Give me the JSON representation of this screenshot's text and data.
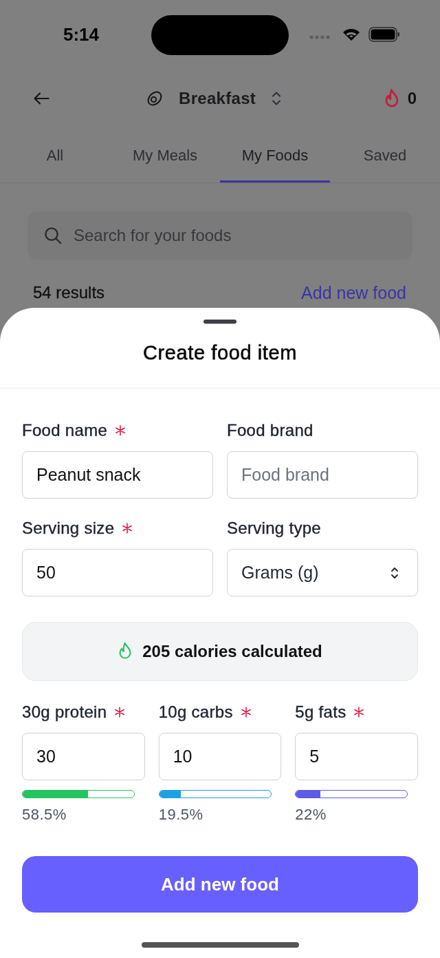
{
  "status_bar": {
    "time": "5:14"
  },
  "header": {
    "meal": "Breakfast",
    "streak": "0"
  },
  "tabs": [
    {
      "label": "All",
      "selected": false
    },
    {
      "label": "My Meals",
      "selected": false
    },
    {
      "label": "My Foods",
      "selected": true
    },
    {
      "label": "Saved",
      "selected": false
    }
  ],
  "search": {
    "placeholder": "Search for your foods"
  },
  "results": {
    "count": "54 results",
    "action": "Add new food"
  },
  "sheet": {
    "title": "Create food item",
    "fields": [
      {
        "label": "Food name",
        "required": true,
        "kind": "text",
        "value": "Peanut snack"
      },
      {
        "label": "Food brand",
        "required": false,
        "kind": "text",
        "placeholder": "Food brand"
      },
      {
        "label": "Serving size",
        "required": true,
        "kind": "text",
        "value": "50"
      },
      {
        "label": "Serving type",
        "required": false,
        "kind": "select",
        "value": "Grams (g)"
      }
    ],
    "calories": "205 calories calculated",
    "macros": [
      {
        "label": "30g protein",
        "required": true,
        "value": "30",
        "level": 0.585,
        "reading": "58.5%",
        "color": "#22c55e"
      },
      {
        "label": "10g carbs",
        "required": true,
        "value": "10",
        "level": 0.195,
        "reading": "19.5%",
        "color": "#1ea1e3"
      },
      {
        "label": "5g fats",
        "required": true,
        "value": "5",
        "level": 0.22,
        "reading": "22%",
        "color": "#5e5ce6"
      }
    ],
    "submit": "Add new food"
  }
}
